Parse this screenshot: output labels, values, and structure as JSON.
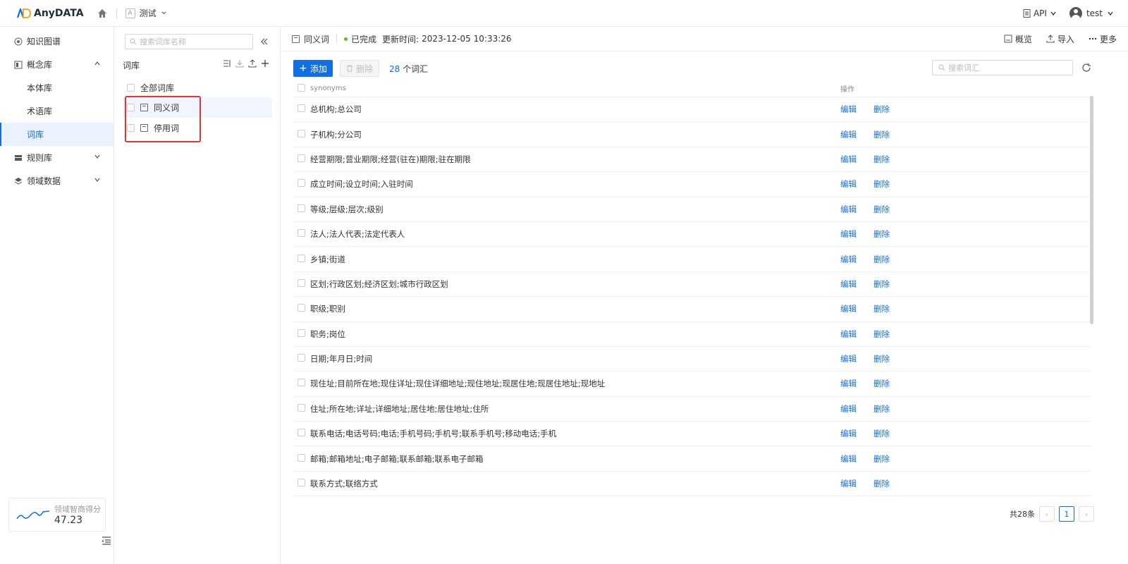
{
  "app": {
    "brand": "AnyDATA",
    "project": "测试",
    "api": "API",
    "user": "test"
  },
  "sidebar": {
    "items": [
      {
        "label": "知识图谱",
        "type": "top"
      },
      {
        "label": "概念库",
        "type": "group-open"
      },
      {
        "label": "本体库",
        "type": "sub"
      },
      {
        "label": "术语库",
        "type": "sub"
      },
      {
        "label": "词库",
        "type": "sub-active"
      },
      {
        "label": "规则库",
        "type": "group"
      },
      {
        "label": "领域数据",
        "type": "group"
      }
    ],
    "score_label": "领域智商得分",
    "score_value": "47.23"
  },
  "library": {
    "search_placeholder": "搜索词库名称",
    "title": "词库",
    "all_label": "全部词库",
    "items": [
      "同义词",
      "停用词"
    ]
  },
  "main": {
    "name": "同义词",
    "status": "已完成",
    "updated_label": "更新时间:",
    "updated_time": "2023-12-05 10:33:26",
    "actions": [
      "概览",
      "导入",
      "更多"
    ],
    "add_label": "添加",
    "delete_label": "删除",
    "count": "28",
    "count_suffix": "个词汇",
    "search_placeholder": "搜索词汇",
    "col_synonyms": "synonyms",
    "col_ops": "操作",
    "edit_label": "编辑",
    "remove_label": "删除",
    "rows": [
      "总机构;总公司",
      "子机构;分公司",
      "经营期限;营业期限;经营(驻在)期限;驻在期限",
      "成立时间;设立时间;入驻时间",
      "等级;层级;层次;级别",
      "法人;法人代表;法定代表人",
      "乡镇;街道",
      "区划;行政区划;经济区划;城市行政区划",
      "职级;职别",
      "职务;岗位",
      "日期;年月日;时间",
      "现住址;目前所在地;现住详址;现住详细地址;现住地址;现居住地;现居住地址;现地址",
      "住址;所在地;详址;详细地址;居住地;居住地址;住所",
      "联系电话;电话号码;电话;手机号码;手机号;联系手机号;移动电话;手机",
      "邮箱;邮箱地址;电子邮箱;联系邮箱;联系电子邮箱",
      "联系方式;联络方式"
    ],
    "total_label": "共28条",
    "page": "1"
  },
  "colors": {
    "accent": "#126ee3",
    "highlight": "#e8322c",
    "success": "#52c41a"
  }
}
